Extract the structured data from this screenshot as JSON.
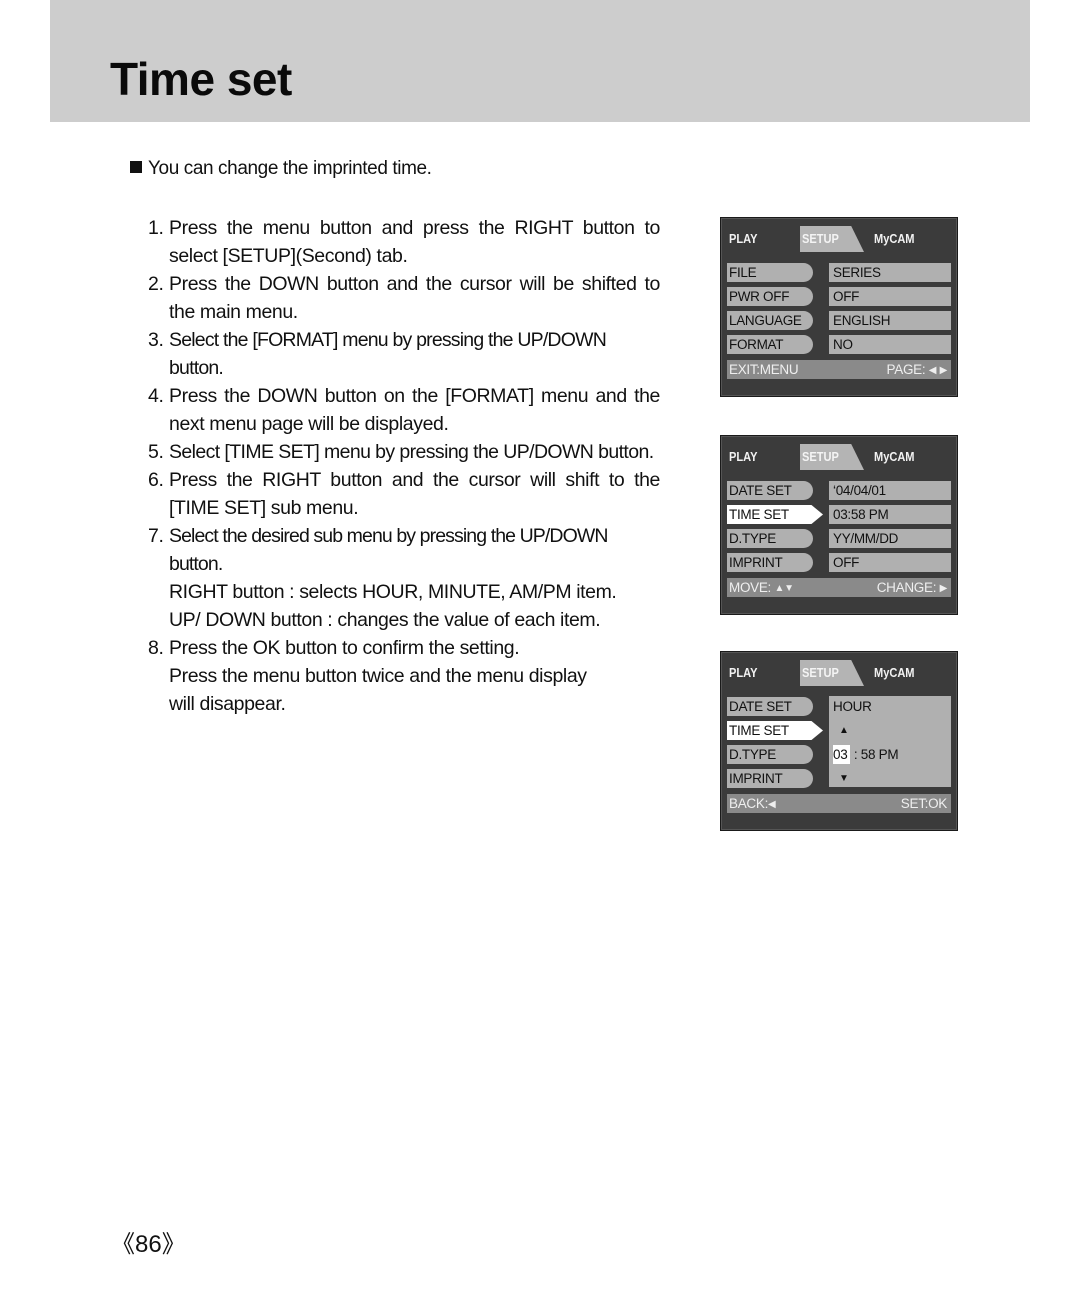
{
  "page": {
    "title": "Time set",
    "intro": "You can change the imprinted time.",
    "page_number": "《86》"
  },
  "steps": [
    {
      "num": "1.",
      "text": "Press the menu button and press the RIGHT button to select [SETUP](Second) tab."
    },
    {
      "num": "2.",
      "text": "Press the DOWN button and the cursor will be shifted to the main menu."
    },
    {
      "num": "3.",
      "text": "Select the [FORMAT] menu by pressing the UP/DOWN button."
    },
    {
      "num": "4.",
      "text": "Press the DOWN button on the [FORMAT] menu and the next menu page will be displayed."
    },
    {
      "num": "5.",
      "text": "Select [TIME SET] menu by pressing the UP/DOWN button."
    },
    {
      "num": "6.",
      "text": "Press the RIGHT button and the cursor will shift to the [TIME SET] sub menu."
    },
    {
      "num": "7.",
      "text": "Select the desired sub menu by pressing the UP/DOWN button.",
      "extra": [
        "RIGHT button : selects HOUR, MINUTE, AM/PM item.",
        "UP/ DOWN button : changes the value of each item."
      ]
    },
    {
      "num": "8.",
      "text": "Press the OK button to confirm the setting.",
      "extra": [
        "Press the menu button twice and the menu display will disappear."
      ]
    }
  ],
  "screens": [
    {
      "tabs": {
        "play": "PLAY",
        "setup": "SETUP",
        "mycam": "MyCAM"
      },
      "rows": [
        {
          "label": "FILE",
          "value": "SERIES"
        },
        {
          "label": "PWR OFF",
          "value": "OFF"
        },
        {
          "label": "LANGUAGE",
          "value": "ENGLISH"
        },
        {
          "label": "FORMAT",
          "value": "NO"
        }
      ],
      "footer": {
        "left": "EXIT:MENU",
        "right": "PAGE:"
      }
    },
    {
      "tabs": {
        "play": "PLAY",
        "setup": "SETUP",
        "mycam": "MyCAM"
      },
      "rows": [
        {
          "label": "DATE SET",
          "value": "‘04/04/01"
        },
        {
          "label": "TIME SET",
          "value": "03:58 PM",
          "selected": true
        },
        {
          "label": "D.TYPE",
          "value": "YY/MM/DD"
        },
        {
          "label": "IMPRINT",
          "value": "OFF"
        }
      ],
      "footer": {
        "left": "MOVE:",
        "right": "CHANGE:"
      }
    },
    {
      "tabs": {
        "play": "PLAY",
        "setup": "SETUP",
        "mycam": "MyCAM"
      },
      "rows": [
        {
          "label": "DATE SET"
        },
        {
          "label": "TIME SET",
          "selected": true
        },
        {
          "label": "D.TYPE"
        },
        {
          "label": "IMPRINT"
        }
      ],
      "sub": {
        "title": "HOUR",
        "hour": "03",
        "sep": " : ",
        "rest": "58 PM"
      },
      "footer": {
        "left": "BACK:",
        "right": "SET:OK"
      }
    }
  ]
}
